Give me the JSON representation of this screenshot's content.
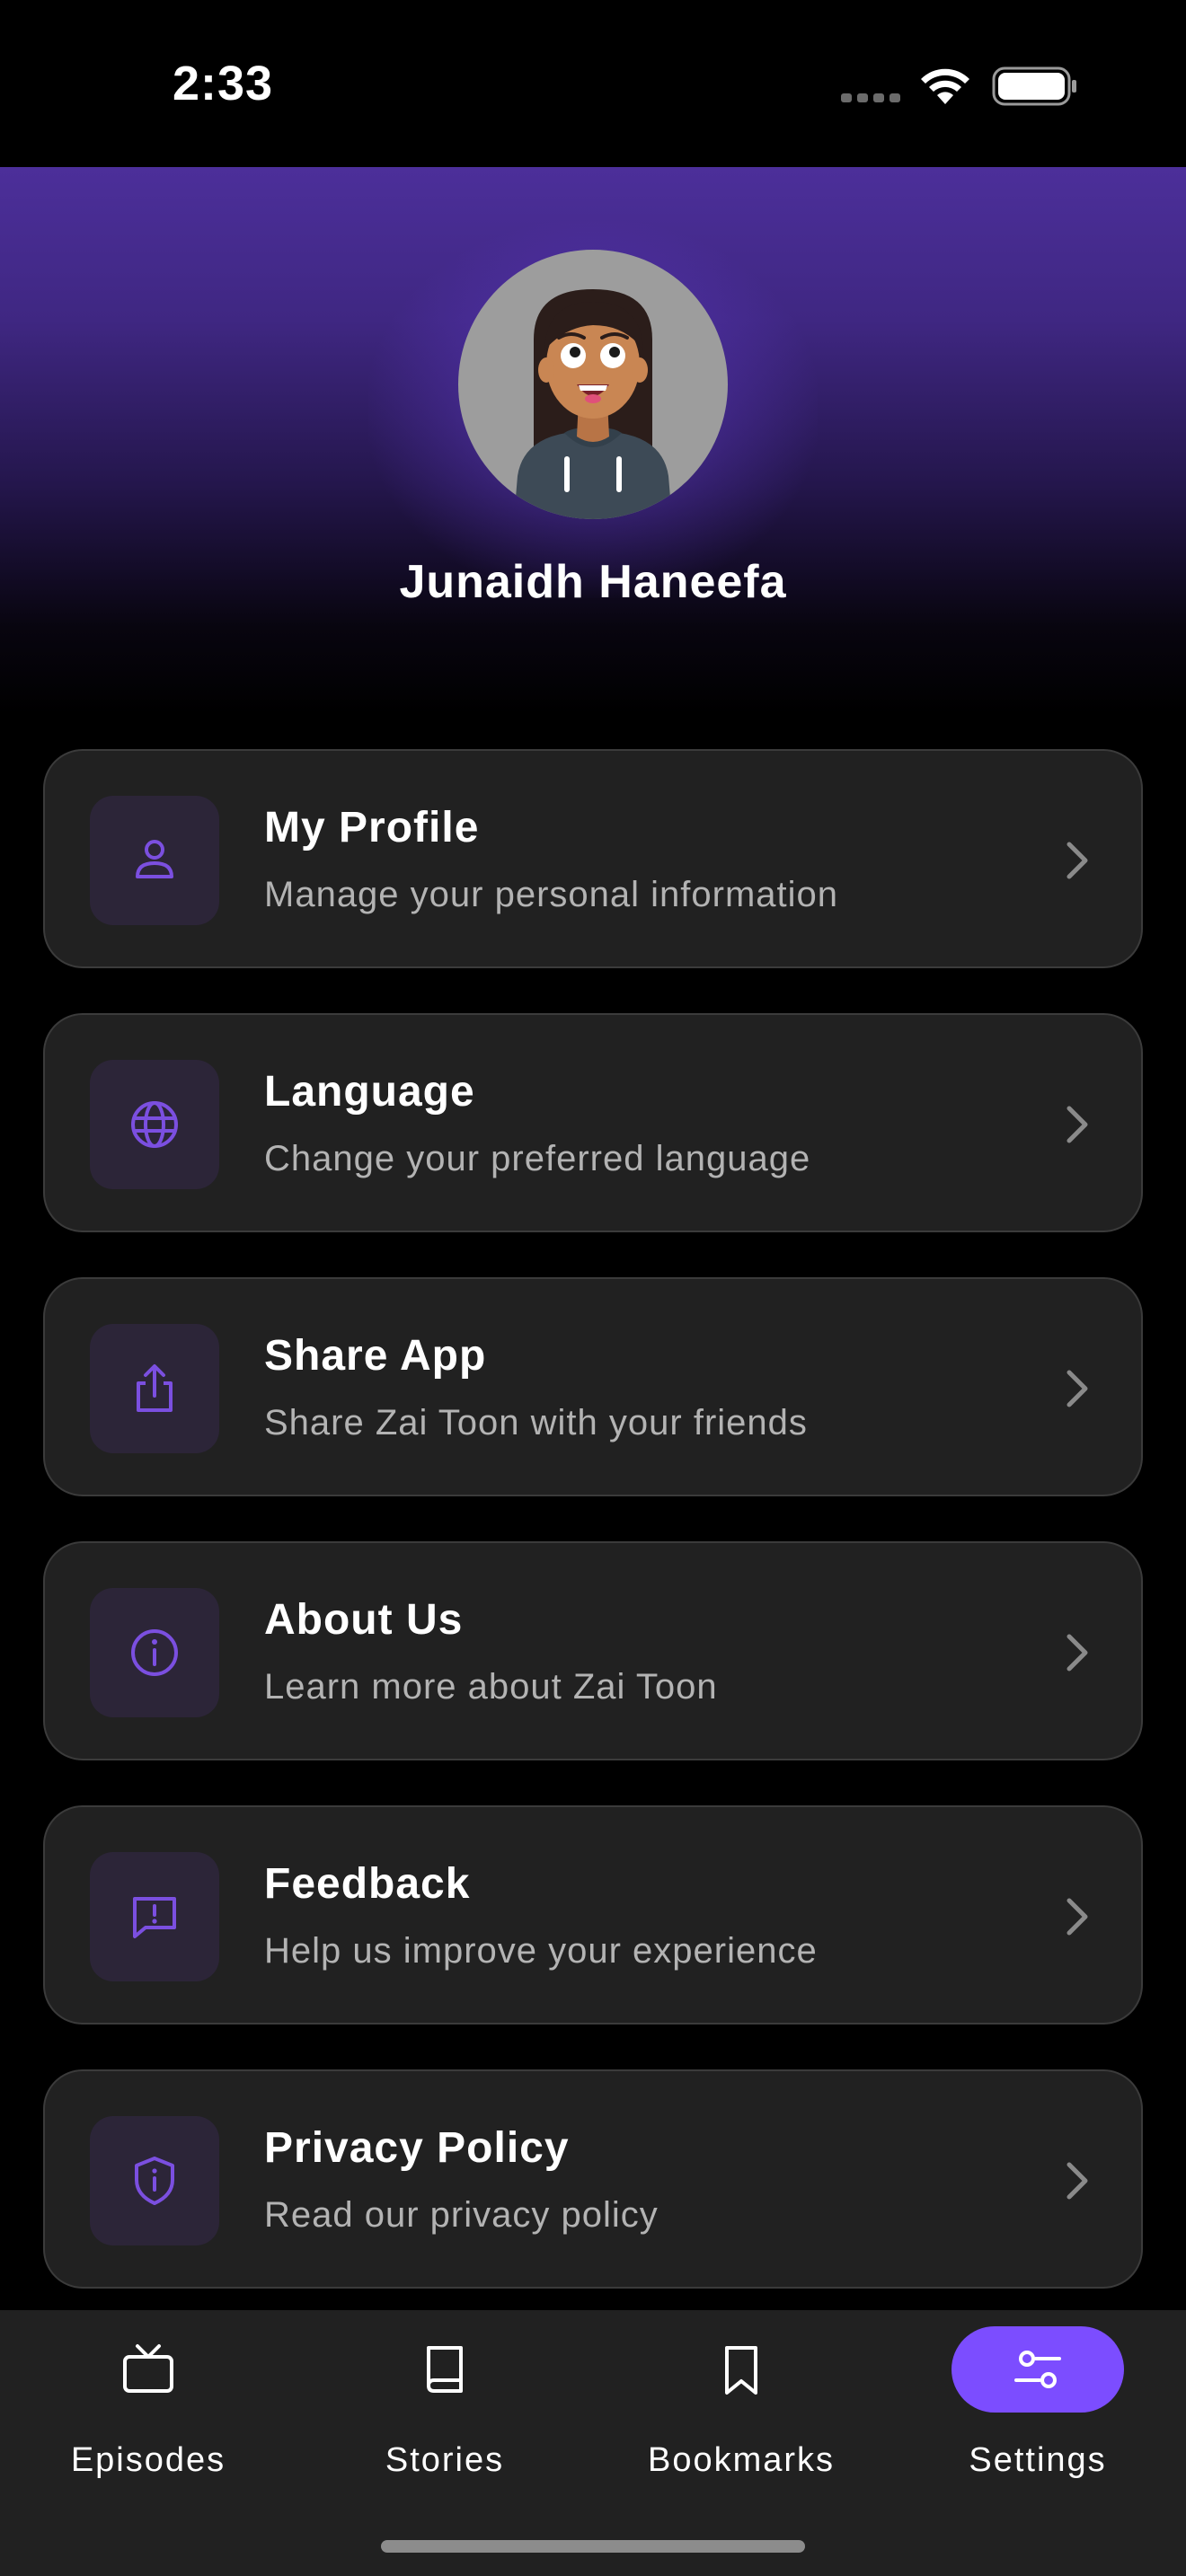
{
  "status_bar": {
    "time": "2:33"
  },
  "profile": {
    "name": "Junaidh Haneefa"
  },
  "menu": [
    {
      "title": "My Profile",
      "subtitle": "Manage your personal information",
      "icon": "person-icon"
    },
    {
      "title": "Language",
      "subtitle": "Change your preferred language",
      "icon": "globe-icon"
    },
    {
      "title": "Share App",
      "subtitle": "Share Zai Toon with your friends",
      "icon": "share-icon"
    },
    {
      "title": "About Us",
      "subtitle": "Learn more about Zai Toon",
      "icon": "info-icon"
    },
    {
      "title": "Feedback",
      "subtitle": "Help us improve your experience",
      "icon": "feedback-icon"
    },
    {
      "title": "Privacy Policy",
      "subtitle": "Read our privacy policy",
      "icon": "shield-icon"
    }
  ],
  "nav": [
    {
      "label": "Episodes",
      "icon": "tv-icon",
      "active": false
    },
    {
      "label": "Stories",
      "icon": "book-icon",
      "active": false
    },
    {
      "label": "Bookmarks",
      "icon": "bookmark-icon",
      "active": false
    },
    {
      "label": "Settings",
      "icon": "sliders-icon",
      "active": true
    }
  ],
  "colors": {
    "accent": "#7c4dff",
    "icon_purple": "#7b4fe0",
    "card": "#212121",
    "background": "#000000"
  }
}
